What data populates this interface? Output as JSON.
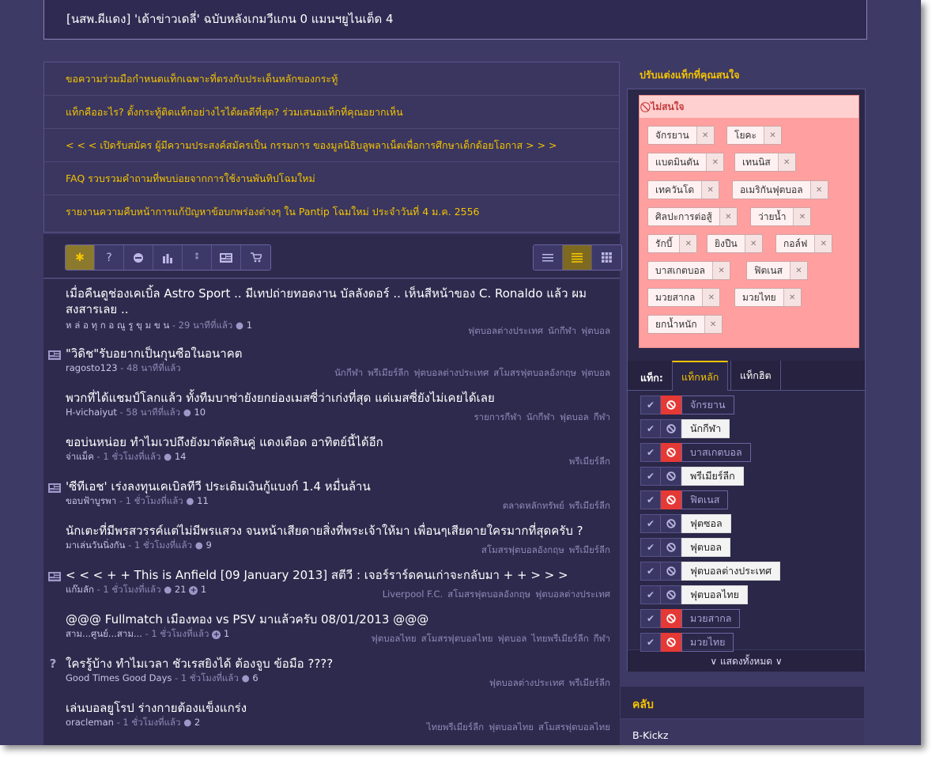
{
  "header": {
    "title": "[นสพ.ผีแดง] 'เด้าข่าวเดลี่' ฉบับหลังเกมวีแกน 0 แมนฯยูไนเต็ด 4"
  },
  "announcements": [
    "ขอความร่วมมือกำหนดแท็กเฉพาะที่ตรงกับประเด็นหลักของกระทู้",
    "แท็กคืออะไร? ตั้งกระทู้ติดแท็กอย่างไรได้ผลดีที่สุด? ร่วมเสนอแท็กที่คุณอยากเห็น",
    "< < < เปิดรับสมัคร ผู้มีความประสงค์สมัครเป็น กรรมการ ของมูลนิธิบลูพลาเน็ตเพื่อการศึกษาเด็กด้อยโอกาส > > >",
    "FAQ รวบรวมคำถามที่พบบ่อยจากการใช้งานพันทิปโฉมใหม่",
    "รายงานความคืบหน้าการแก้ปัญหาข้อบกพร่องต่างๆ ใน Pantip โฉมใหม่ ประจำวันที่ 4 ม.ค. 2556"
  ],
  "toolbar": {
    "filter_icons": [
      "asterisk-icon",
      "question-icon",
      "chat-icon",
      "bar-chart-icon",
      "sparkle-icon",
      "news-icon",
      "cart-icon"
    ],
    "view_icons": [
      "list-view-icon",
      "compact-view-icon",
      "grid-view-icon"
    ]
  },
  "topics": [
    {
      "icon": "",
      "title": "เมื่อคืนดูช่องเคเบิ้ล Astro Sport .. มีเทปถ่ายทอดงาน บัลลังดอร์ .. เห็นสีหน้าของ C. Ronaldo แล้ว ผมสงสารเลย ..",
      "author": "ห ล่ อ ทุ ก อ ณู รู ขุ ม ข น",
      "time": "- 29 นาทีที่แล้ว",
      "comments": "1",
      "votes": "",
      "tags": [
        "ฟุตบอลต่างประเทศ",
        "นักกีฬา",
        "ฟุตบอล"
      ]
    },
    {
      "icon": "news",
      "title": "\"วิดิช\"รับอยากเป็นกุนซือในอนาคต",
      "author": "ragosto123",
      "time": "- 48 นาทีที่แล้ว",
      "comments": "",
      "votes": "",
      "tags": [
        "นักกีฬา",
        "พรีเมียร์ลีก",
        "ฟุตบอลต่างประเทศ",
        "สโมสรฟุตบอลอังกฤษ",
        "ฟุตบอล"
      ]
    },
    {
      "icon": "",
      "title": "พวกที่ได้แชมป์โลกแล้ว ทั้งทีมบาซ่ายังยกย่องเมสซี่ว่าเก่งที่สุด แต่เมสซี่ยังไม่เคยได้เลย",
      "author": "H-vichaiyut",
      "time": "- 58 นาทีที่แล้ว",
      "comments": "10",
      "votes": "",
      "tags": [
        "รายการกีฬา",
        "นักกีฬา",
        "ฟุตบอล",
        "กีฬา"
      ]
    },
    {
      "icon": "",
      "title": "ขอบ่นหน่อย ทำไมเวปถึงยังมาตัดสินคู่ แดงเดือด อาทิตย์นี้ได้อีก",
      "author": "จ่าแม็ค",
      "time": "- 1 ชั่วโมงที่แล้ว",
      "comments": "14",
      "votes": "",
      "tags": [
        "พรีเมียร์ลีก"
      ]
    },
    {
      "icon": "news",
      "title": "'ซีทีเอช' เร่งลงทุนเคเบิลทีวี ประเดิมเงินกู้แบงก์ 1.4 หมื่นล้าน",
      "author": "ขอบฟ้าบูรพา",
      "time": "- 1 ชั่วโมงที่แล้ว",
      "comments": "11",
      "votes": "",
      "tags": [
        "ตลาดหลักทรัพย์",
        "พรีเมียร์ลีก"
      ]
    },
    {
      "icon": "",
      "title": "นักเตะที่มีพรสวรรค์แต่ไม่มีพรแสวง จนหน้าเสียดายสิ่งที่พระเจ้าให้มา เพื่อนๆเสียดายใครมากที่สุดครับ ?",
      "author": "มาเล่นวันนิ่งกัน",
      "time": "- 1 ชั่วโมงที่แล้ว",
      "comments": "9",
      "votes": "",
      "tags": [
        "สโมสรฟุตบอลอังกฤษ",
        "พรีเมียร์ลีก"
      ]
    },
    {
      "icon": "news",
      "title": "< < < + + This is Anfield [09 January 2013] สตีวี : เจอร์ราร์ดคนเก่าจะกลับมา + + > > >",
      "author": "แก๊มลัก",
      "time": "- 1 ชั่วโมงที่แล้ว",
      "comments": "21",
      "votes": "1",
      "tags": [
        "Liverpool F.C.",
        "สโมสรฟุตบอลอังกฤษ",
        "ฟุตบอลต่างประเทศ"
      ]
    },
    {
      "icon": "",
      "title": "@@@ Fullmatch เมืองทอง vs PSV มาแล้วครับ 08/01/2013 @@@",
      "author": "สาม...ศูนย์...สาม...",
      "time": "- 1 ชั่วโมงที่แล้ว",
      "comments": "",
      "votes": "1",
      "tags": [
        "ฟุตบอลไทย",
        "สโมสรฟุตบอลไทย",
        "ฟุตบอล",
        "ไทยพรีเมียร์ลีก",
        "กีฬา"
      ]
    },
    {
      "icon": "question",
      "title": "ใครรู้บ้าง ทำไมเวลา ชัวเรสยิงได้ ต้องจูบ ข้อมือ ????",
      "author": "Good Times Good Days",
      "time": "- 1 ชั่วโมงที่แล้ว",
      "comments": "6",
      "votes": "",
      "tags": [
        "ฟุตบอลต่างประเทศ",
        "พรีเมียร์ลีก"
      ]
    },
    {
      "icon": "",
      "title": "เล่นบอลยูโรป ร่างกายต้องแข็งแกร่ง",
      "author": "oracleman",
      "time": "- 1 ชั่วโมงที่แล้ว",
      "comments": "2",
      "votes": "",
      "tags": [
        "ไทยพรีเมียร์ลีก",
        "ฟุตบอลไทย",
        "สโมสรฟุตบอลไทย"
      ]
    }
  ],
  "sidebar": {
    "title": "ปรับแต่งแท็กที่คุณสนใจ",
    "nointerest_label": "ไม่สนใจ",
    "blocked_chips": [
      "จักรยาน",
      "โยคะ",
      "แบดมินตัน",
      "เทนนิส",
      "เทควันโด",
      "อเมริกันฟุตบอล",
      "ศิลปะการต่อสู้",
      "ว่ายน้ำ",
      "รักบี้",
      "ยิงปืน",
      "กอล์ฟ",
      "บาสเกตบอล",
      "ฟิตเนส",
      "มวยสากล",
      "มวยไทย",
      "ยกน้ำหนัก"
    ],
    "tags_label": "แท็ก:",
    "tab_main": "แท็กหลัก",
    "tab_hit": "แท็กฮิต",
    "tag_list": [
      {
        "name": "จักรยาน",
        "blocked": true
      },
      {
        "name": "นักกีฬา",
        "blocked": false
      },
      {
        "name": "บาสเกตบอล",
        "blocked": true
      },
      {
        "name": "พรีเมียร์ลีก",
        "blocked": false
      },
      {
        "name": "ฟิตเนส",
        "blocked": true
      },
      {
        "name": "ฟุตซอล",
        "blocked": false
      },
      {
        "name": "ฟุตบอล",
        "blocked": false
      },
      {
        "name": "ฟุตบอลต่างประเทศ",
        "blocked": false
      },
      {
        "name": "ฟุตบอลไทย",
        "blocked": false
      },
      {
        "name": "มวยสากล",
        "blocked": true
      },
      {
        "name": "มวยไทย",
        "blocked": true
      }
    ],
    "show_all": "∨ แสดงทั้งหมด ∨",
    "club_title": "คลับ",
    "club_first": "B-Kickz"
  },
  "colors": {
    "background": "#3e3a66",
    "accent": "#f5c400",
    "block_red": "#e53935",
    "nointerest_bg": "#ff9f9f"
  }
}
